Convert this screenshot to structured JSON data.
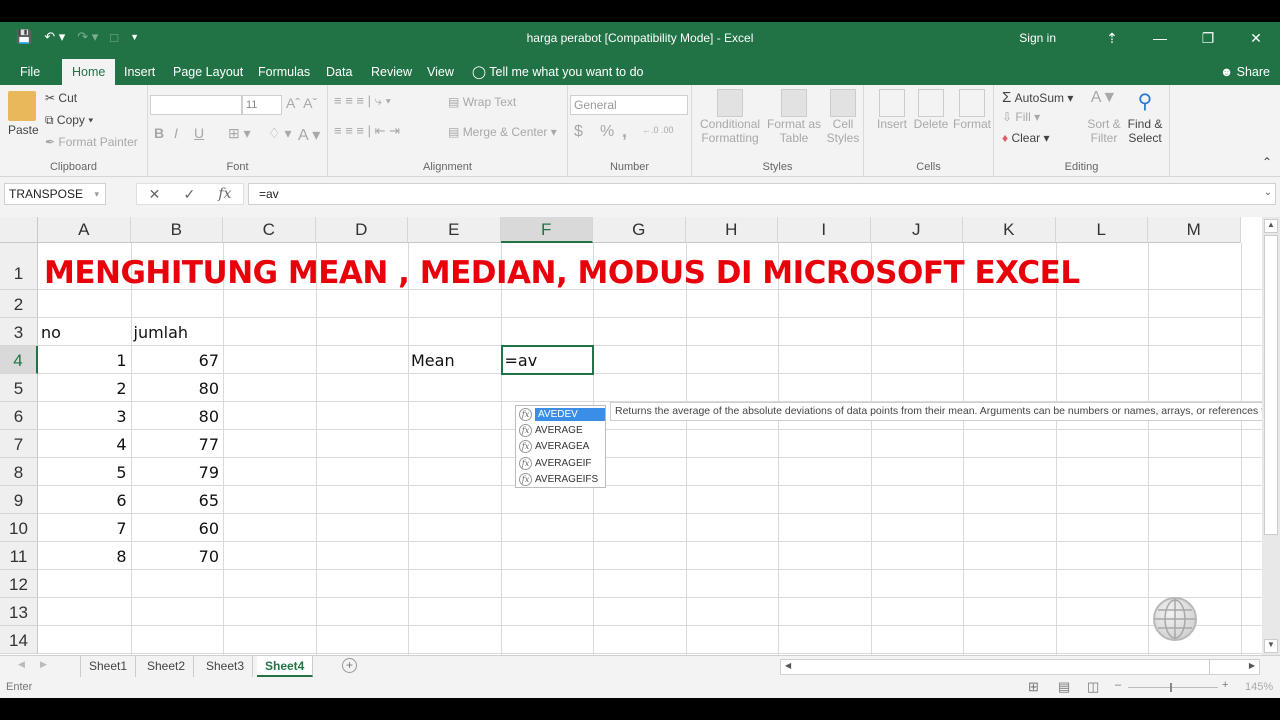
{
  "app": {
    "title": "harga perabot  [Compatibility Mode]  -  Excel",
    "sign_in": "Sign in",
    "share": "Share",
    "tell_me": "Tell me what you want to do"
  },
  "ribbon_tabs": [
    "File",
    "Home",
    "Insert",
    "Page Layout",
    "Formulas",
    "Data",
    "Review",
    "View"
  ],
  "active_tab": "Home",
  "clipboard": {
    "paste": "Paste",
    "cut": "Cut",
    "copy": "Copy",
    "format_painter": "Format Painter",
    "label": "Clipboard"
  },
  "font": {
    "name": "",
    "size": "11",
    "label": "Font",
    "bold": "B",
    "italic": "I",
    "underline": "U"
  },
  "alignment": {
    "wrap_text": "Wrap Text",
    "merge_center": "Merge & Center",
    "label": "Alignment"
  },
  "number": {
    "format": "General",
    "label": "Number",
    "currency": "$",
    "percent": "%",
    "comma": ","
  },
  "styles": {
    "conditional": "Conditional",
    "conditional2": "Formatting",
    "format_table": "Format as",
    "format_table2": "Table",
    "cell_styles": "Cell",
    "cell_styles2": "Styles",
    "label": "Styles"
  },
  "cells": {
    "insert": "Insert",
    "delete": "Delete",
    "format": "Format",
    "label": "Cells"
  },
  "editing": {
    "autosum": "AutoSum",
    "fill": "Fill",
    "clear": "Clear",
    "sort": "Sort &",
    "sort2": "Filter",
    "find": "Find &",
    "find2": "Select",
    "label": "Editing"
  },
  "formula_bar": {
    "name_box": "TRANSPOSE",
    "formula": "=av"
  },
  "columns": [
    "A",
    "B",
    "C",
    "D",
    "E",
    "F",
    "G",
    "H",
    "I",
    "J",
    "K",
    "L",
    "M"
  ],
  "selected_column": "F",
  "rows": [
    "1",
    "2",
    "3",
    "4",
    "5",
    "6",
    "7",
    "8",
    "9",
    "10",
    "11",
    "12",
    "13",
    "14"
  ],
  "selected_row": "4",
  "sheet": {
    "heading": "MENGHITUNG MEAN , MEDIAN, MODUS DI MICROSOFT EXCEL",
    "header_no": "no",
    "header_jumlah": "jumlah",
    "data": [
      {
        "no": "1",
        "jumlah": "67"
      },
      {
        "no": "2",
        "jumlah": "80"
      },
      {
        "no": "3",
        "jumlah": "80"
      },
      {
        "no": "4",
        "jumlah": "77"
      },
      {
        "no": "5",
        "jumlah": "79"
      },
      {
        "no": "6",
        "jumlah": "65"
      },
      {
        "no": "7",
        "jumlah": "60"
      },
      {
        "no": "8",
        "jumlah": "70"
      }
    ],
    "mean_label": "Mean",
    "edit_value": "=av"
  },
  "autocomplete": {
    "items": [
      "AVEDEV",
      "AVERAGE",
      "AVERAGEA",
      "AVERAGEIF",
      "AVERAGEIFS"
    ],
    "selected": "AVEDEV",
    "tooltip": "Returns the average of the absolute deviations of data points from their mean. Arguments can be numbers or names, arrays, or references that contain numbers."
  },
  "sheet_tabs": [
    "Sheet1",
    "Sheet2",
    "Sheet3",
    "Sheet4"
  ],
  "active_sheet": "Sheet4",
  "status": {
    "mode": "Enter",
    "zoom": "145%"
  },
  "colors": {
    "excel_green": "#217346",
    "heading_red": "#e8000b",
    "selection_blue": "#3a8ee6"
  }
}
